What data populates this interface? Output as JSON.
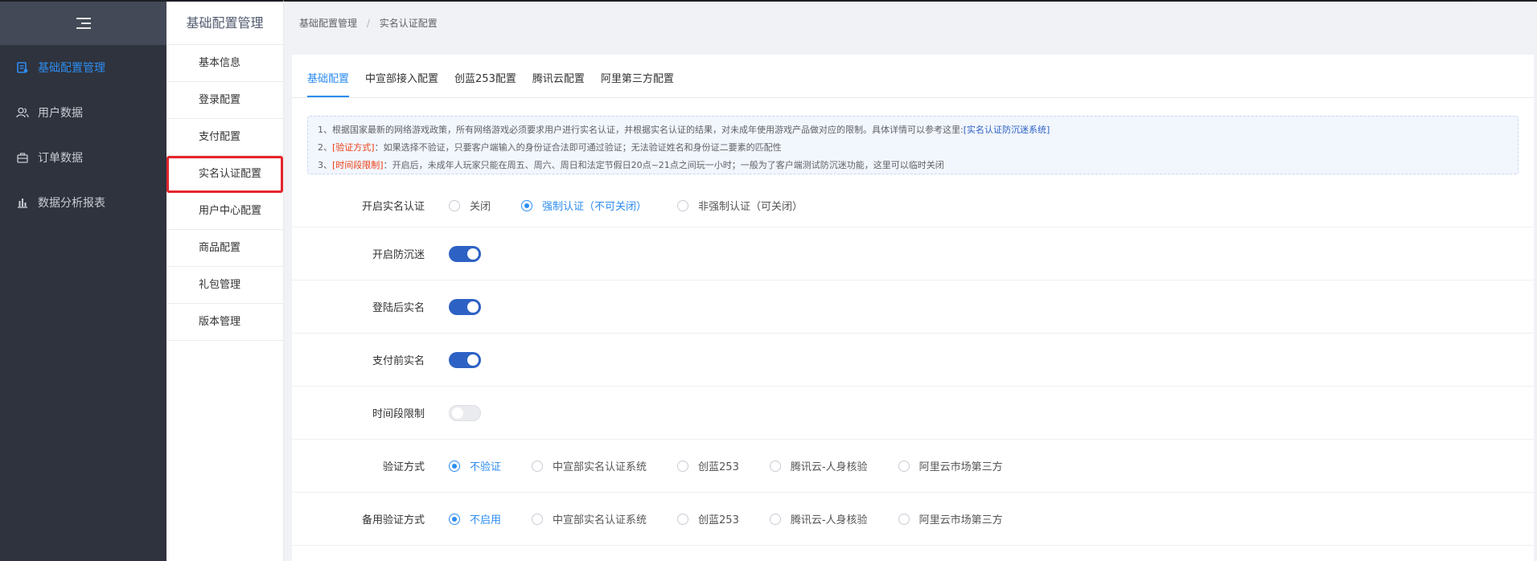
{
  "sidebar": {
    "items": [
      {
        "label": "基础配置管理",
        "icon": "config-icon",
        "active": true
      },
      {
        "label": "用户数据",
        "icon": "users-icon",
        "active": false
      },
      {
        "label": "订单数据",
        "icon": "order-icon",
        "active": false
      },
      {
        "label": "数据分析报表",
        "icon": "bar-chart-icon",
        "active": false
      }
    ]
  },
  "submenu": {
    "title": "基础配置管理",
    "items": [
      {
        "label": "基本信息"
      },
      {
        "label": "登录配置"
      },
      {
        "label": "支付配置"
      },
      {
        "label": "实名认证配置"
      },
      {
        "label": "用户中心配置"
      },
      {
        "label": "商品配置"
      },
      {
        "label": "礼包管理"
      },
      {
        "label": "版本管理"
      }
    ]
  },
  "breadcrumb": {
    "root": "基础配置管理",
    "separator": "/",
    "current": "实名认证配置"
  },
  "tabs": [
    {
      "label": "基础配置",
      "active": true
    },
    {
      "label": "中宣部接入配置",
      "active": false
    },
    {
      "label": "创蓝253配置",
      "active": false
    },
    {
      "label": "腾讯云配置",
      "active": false
    },
    {
      "label": "阿里第三方配置",
      "active": false
    }
  ],
  "notice": {
    "line1_text": "1、根据国家最新的网络游戏政策，所有网络游戏必须要求用户进行实名认证，并根据实名认证的结果，对未成年使用游戏产品做对应的限制。具体详情可以参考这里:",
    "line1_link": "[实名认证防沉迷系统]",
    "line2_prefix": "2、",
    "line2_tag": "[验证方式]",
    "line2_text": "：如果选择不验证，只要客户端输入的身份证合法即可通过验证；无法验证姓名和身份证二要素的匹配性",
    "line3_prefix": "3、",
    "line3_tag": "[时间段限制]",
    "line3_text": "：开启后，未成年人玩家只能在周五、周六、周日和法定节假日20点~21点之间玩一小时；一般为了客户端测试防沉迷功能，这里可以临时关闭"
  },
  "form": {
    "realname": {
      "label": "开启实名认证",
      "options": [
        "关闭",
        "强制认证（不可关闭）",
        "非强制认证（可关闭）"
      ],
      "selected": 1
    },
    "anti_addiction": {
      "label": "开启防沉迷",
      "on": true
    },
    "after_login": {
      "label": "登陆后实名",
      "on": true
    },
    "before_pay": {
      "label": "支付前实名",
      "on": true
    },
    "time_limit": {
      "label": "时间段限制",
      "on": false
    },
    "verify_method": {
      "label": "验证方式",
      "options": [
        "不验证",
        "中宣部实名认证系统",
        "创蓝253",
        "腾讯云-人身核验",
        "阿里云市场第三方"
      ],
      "selected": 0
    },
    "backup_method": {
      "label": "备用验证方式",
      "options": [
        "不启用",
        "中宣部实名认证系统",
        "创蓝253",
        "腾讯云-人身核验",
        "阿里云市场第三方"
      ],
      "selected": 0
    }
  },
  "colors": {
    "accent": "#2d8cf0",
    "sidebar_bg": "#2f333d",
    "highlight_box": "#e5252c",
    "notice_red": "#ed3f14"
  }
}
